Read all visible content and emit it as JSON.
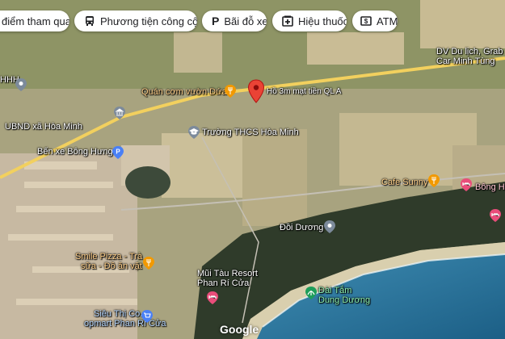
{
  "chips": {
    "attractions": "điểm tham quan",
    "transit": "Phương tiện công cộ...",
    "parking": "Bãi đỗ xe",
    "pharmacy": "Hiệu thuốc",
    "atm": "ATM"
  },
  "places": {
    "dv_du_lich": "DV Du lịch, Grab",
    "car_minh_tung": "Car Minh Tùng",
    "hhh": "HHH",
    "quan_com": "Quán cơm vườn Dứa",
    "dropped_pin_addr": "Hồ 3m mạt tiền QL A",
    "ubnd": "UBND xã Hòa Minh",
    "truong_thcs": "Trường THCS Hòa Minh",
    "ben_xe": "Bến xe Bông Hưng",
    "cafe_sunny": "Cafe Sunny",
    "bong_he": "Bông Hé",
    "doi_duong": "Đồi Dương",
    "smile_pizza_1": "Smile Pizza - Trà",
    "smile_pizza_2": "sữa - Đồ ăn vặt",
    "mui_tau_1": "Mũi Tàu Resort",
    "mui_tau_2": "Phan Rí Cửa",
    "dai_tam_1": "Đài Tắm",
    "dai_tam_2": "Dung Dương",
    "sieu_thi_1": "Siêu Thị Co.",
    "sieu_thi_2": "opmart Phan Rí Cửa"
  },
  "brand": "Google",
  "colors": {
    "pin_red": "#ea4335",
    "food_orange": "#f29900",
    "blue_poi": "#4a80f5",
    "hotel_pink": "#e94d7a",
    "park_green": "#1e9e5a",
    "gray_poi": "#7c8a9b",
    "road_yellow": "#f2d05e"
  }
}
